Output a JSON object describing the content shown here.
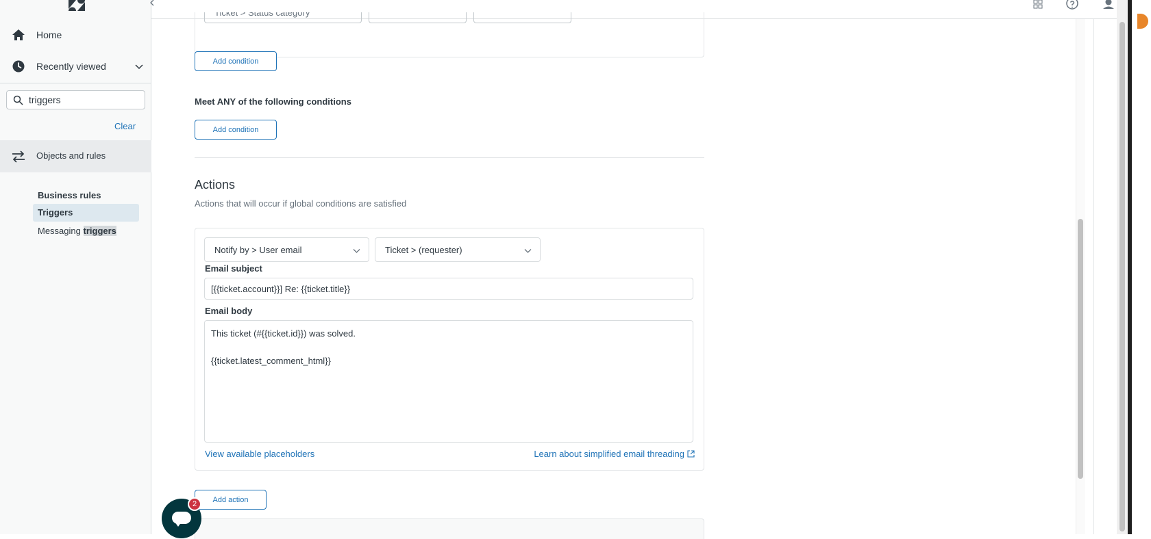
{
  "sidebar": {
    "home_label": "Home",
    "recent_label": "Recently viewed",
    "search_value": "triggers",
    "clear_label": "Clear",
    "objects_label": "Objects and rules",
    "business_rules_heading": "Business rules",
    "triggers_label": "Triggers",
    "messaging_prefix": "Messaging",
    "messaging_highlight": "triggers"
  },
  "conditions": {
    "top_select_1": "Ticket > Status category",
    "add_condition_label": "Add condition",
    "meet_any_label": "Meet ANY of the following conditions"
  },
  "actions": {
    "heading": "Actions",
    "description": "Actions that will occur if global conditions are satisfied",
    "notify_select": "Notify by > User email",
    "recipient_select": "Ticket > (requester)",
    "email_subject_label": "Email subject",
    "email_subject_value": "[{{ticket.account}}] Re: {{ticket.title}}",
    "email_body_label": "Email body",
    "email_body_value": "This ticket (#{{ticket.id}}) was solved.\n\n{{ticket.latest_comment_html}}",
    "placeholders_link": "View available placeholders",
    "threading_link": "Learn about simplified email threading",
    "add_action_label": "Add action"
  },
  "chat": {
    "badge_count": "2"
  },
  "colors": {
    "accent": "#1f73b7",
    "chat_bg": "#03363d",
    "badge": "#cc3340"
  }
}
